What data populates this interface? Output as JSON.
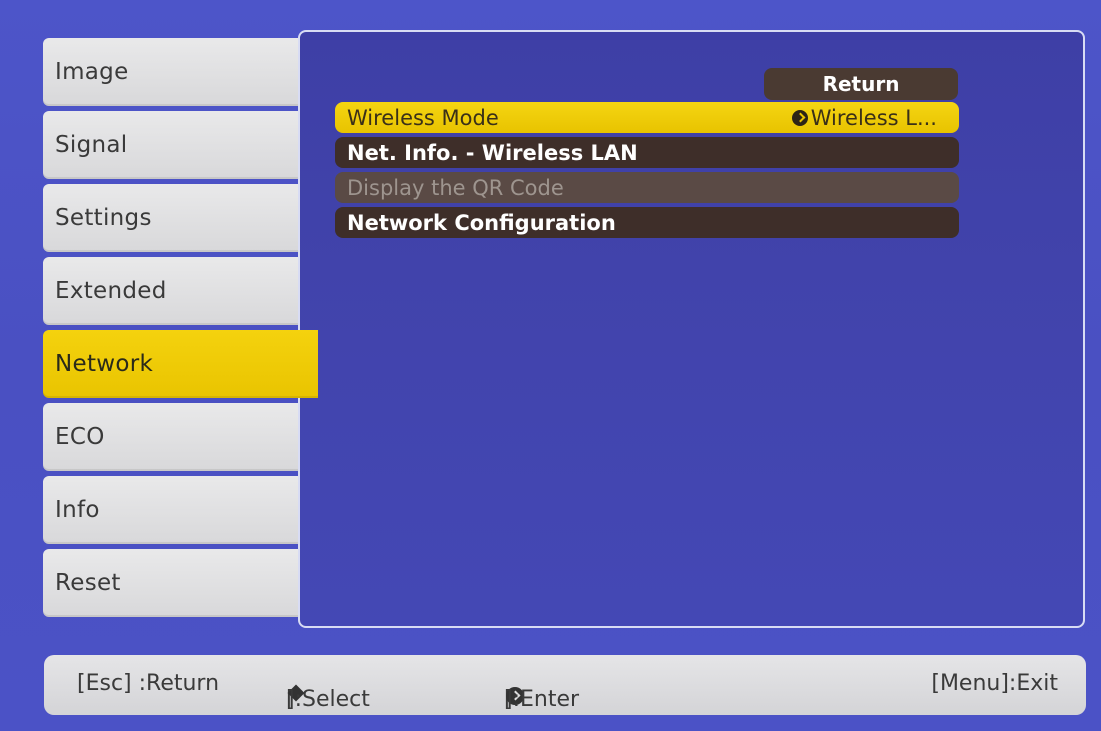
{
  "tabs": [
    {
      "label": "Image"
    },
    {
      "label": "Signal"
    },
    {
      "label": "Settings"
    },
    {
      "label": "Extended"
    },
    {
      "label": "Network",
      "active": true
    },
    {
      "label": "ECO"
    },
    {
      "label": "Info"
    },
    {
      "label": "Reset"
    }
  ],
  "panel": {
    "return_label": "Return",
    "items": [
      {
        "label": "Wireless Mode",
        "value": "Wireless L...",
        "state": "selected"
      },
      {
        "label": "Net. Info. - Wireless LAN",
        "state": "normal"
      },
      {
        "label": "Display the QR Code",
        "state": "disabled"
      },
      {
        "label": "Network Configuration",
        "state": "normal"
      }
    ]
  },
  "footer": {
    "esc": "[Esc] :Return",
    "select_prefix": "[",
    "select_suffix": "]:Select",
    "enter_prefix": "[",
    "enter_suffix": "]:Enter",
    "menu": "[Menu]:Exit"
  },
  "colors": {
    "background": "#4a50c2",
    "accent": "#f0cc00",
    "tab": "#e0e0e2",
    "item": "#3e2e29"
  },
  "icons": {
    "select": "up-down-diamond-icon",
    "enter": "enter-circle-icon"
  }
}
